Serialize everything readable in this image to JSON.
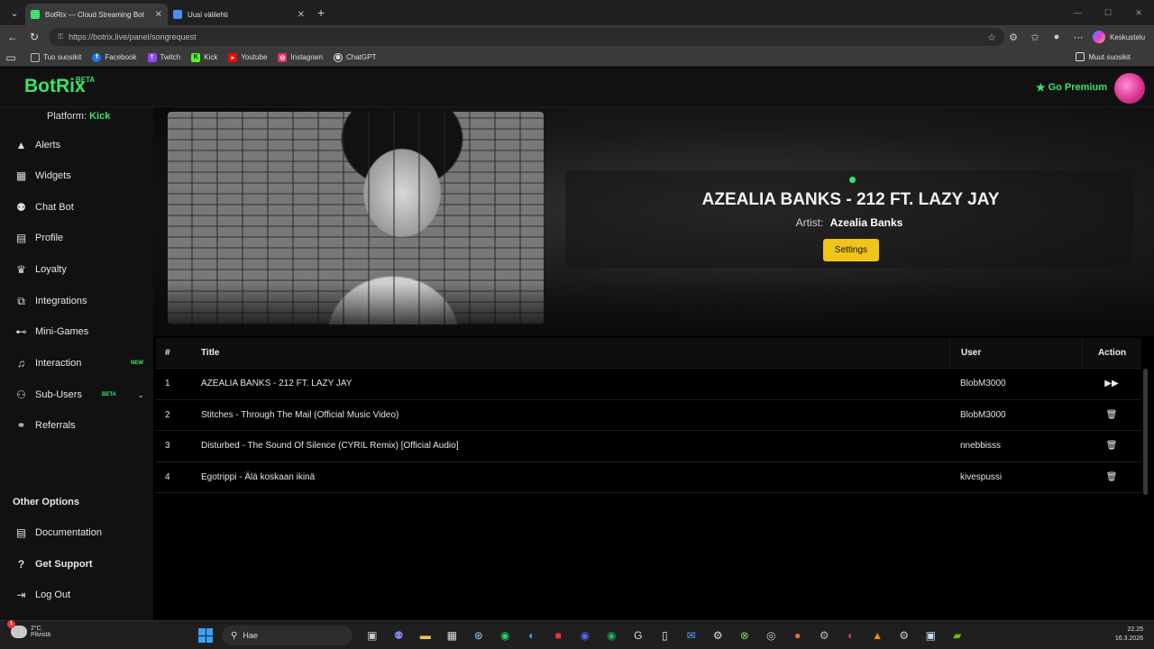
{
  "browser": {
    "tabs": [
      {
        "label": "BotRix — Cloud Streaming Bot",
        "active": true,
        "color": "#3be36b"
      },
      {
        "label": "Uusi välilehti",
        "active": false,
        "color": "#4a8df6"
      }
    ],
    "new_tab": "+",
    "url": "https://botrix.live/panel/songrequest",
    "copilot_label": "Keskustelu",
    "bookmarks": [
      {
        "label": "Tuo suosikit",
        "icon": "import-icon",
        "color": "#bbbbbb"
      },
      {
        "label": "Facebook",
        "icon": "facebook-icon",
        "color": "#1877f2"
      },
      {
        "label": "Twitch",
        "icon": "twitch-icon",
        "color": "#9146ff"
      },
      {
        "label": "Kick",
        "icon": "kick-icon",
        "color": "#53fc18"
      },
      {
        "label": "Youtube",
        "icon": "youtube-icon",
        "color": "#ff0000"
      },
      {
        "label": "Instagram",
        "icon": "instagram-icon",
        "color": "#e1306c"
      },
      {
        "label": "ChatGPT",
        "icon": "chatgpt-icon",
        "color": "#dddddd"
      }
    ],
    "other_bookmarks": "Muut suosikit"
  },
  "app": {
    "logo": "BotRix",
    "logo_badge": "BETA",
    "premium_label": "Go Premium",
    "accent_color": "#3be36b",
    "platform_label": "Platform:",
    "platform_value": "Kick",
    "nav": [
      {
        "label": "Alerts",
        "icon": "warning-icon"
      },
      {
        "label": "Widgets",
        "icon": "widgets-icon"
      },
      {
        "label": "Chat Bot",
        "icon": "robot-icon"
      },
      {
        "label": "Profile",
        "icon": "id-card-icon"
      },
      {
        "label": "Loyalty",
        "icon": "trophy-icon"
      },
      {
        "label": "Integrations",
        "icon": "integrations-icon"
      },
      {
        "label": "Mini-Games",
        "icon": "gamepad-icon"
      },
      {
        "label": "Interaction",
        "icon": "music-icon",
        "badge": "NEW"
      },
      {
        "label": "Sub-Users",
        "icon": "users-icon",
        "badge": "BETA"
      },
      {
        "label": "Referrals",
        "icon": "referrals-icon"
      }
    ],
    "other_options_title": "Other Options",
    "other_nav": [
      {
        "label": "Documentation",
        "icon": "docs-icon"
      },
      {
        "label": "Get Support",
        "icon": "help-icon"
      },
      {
        "label": "Log Out",
        "icon": "logout-icon"
      }
    ]
  },
  "now_playing": {
    "title": "AZEALIA BANKS - 212 FT. LAZY JAY",
    "artist_label": "Artist:",
    "artist": "Azealia Banks",
    "settings_label": "Settings"
  },
  "queue": {
    "headers": {
      "num": "#",
      "title": "Title",
      "user": "User",
      "action": "Action"
    },
    "rows": [
      {
        "num": "1",
        "title": "AZEALIA BANKS - 212 FT. LAZY JAY",
        "user": "BlobM3000",
        "action": "skip-icon"
      },
      {
        "num": "2",
        "title": "Stitches - Through The Mail (Official Music Video)",
        "user": "BlobM3000",
        "action": "trash-icon"
      },
      {
        "num": "3",
        "title": "Disturbed - The Sound Of Silence (CYRIL Remix) [Official Audio]",
        "user": "nnebbisss",
        "action": "trash-icon"
      },
      {
        "num": "4",
        "title": "Egotrippi - Älä koskaan ikinä",
        "user": "kivespussi",
        "action": "trash-icon"
      }
    ]
  },
  "taskbar": {
    "temperature": "2°C",
    "weather": "Pilvistä",
    "search_placeholder": "Hae",
    "time": "22.25",
    "date": "16.3.2026"
  }
}
